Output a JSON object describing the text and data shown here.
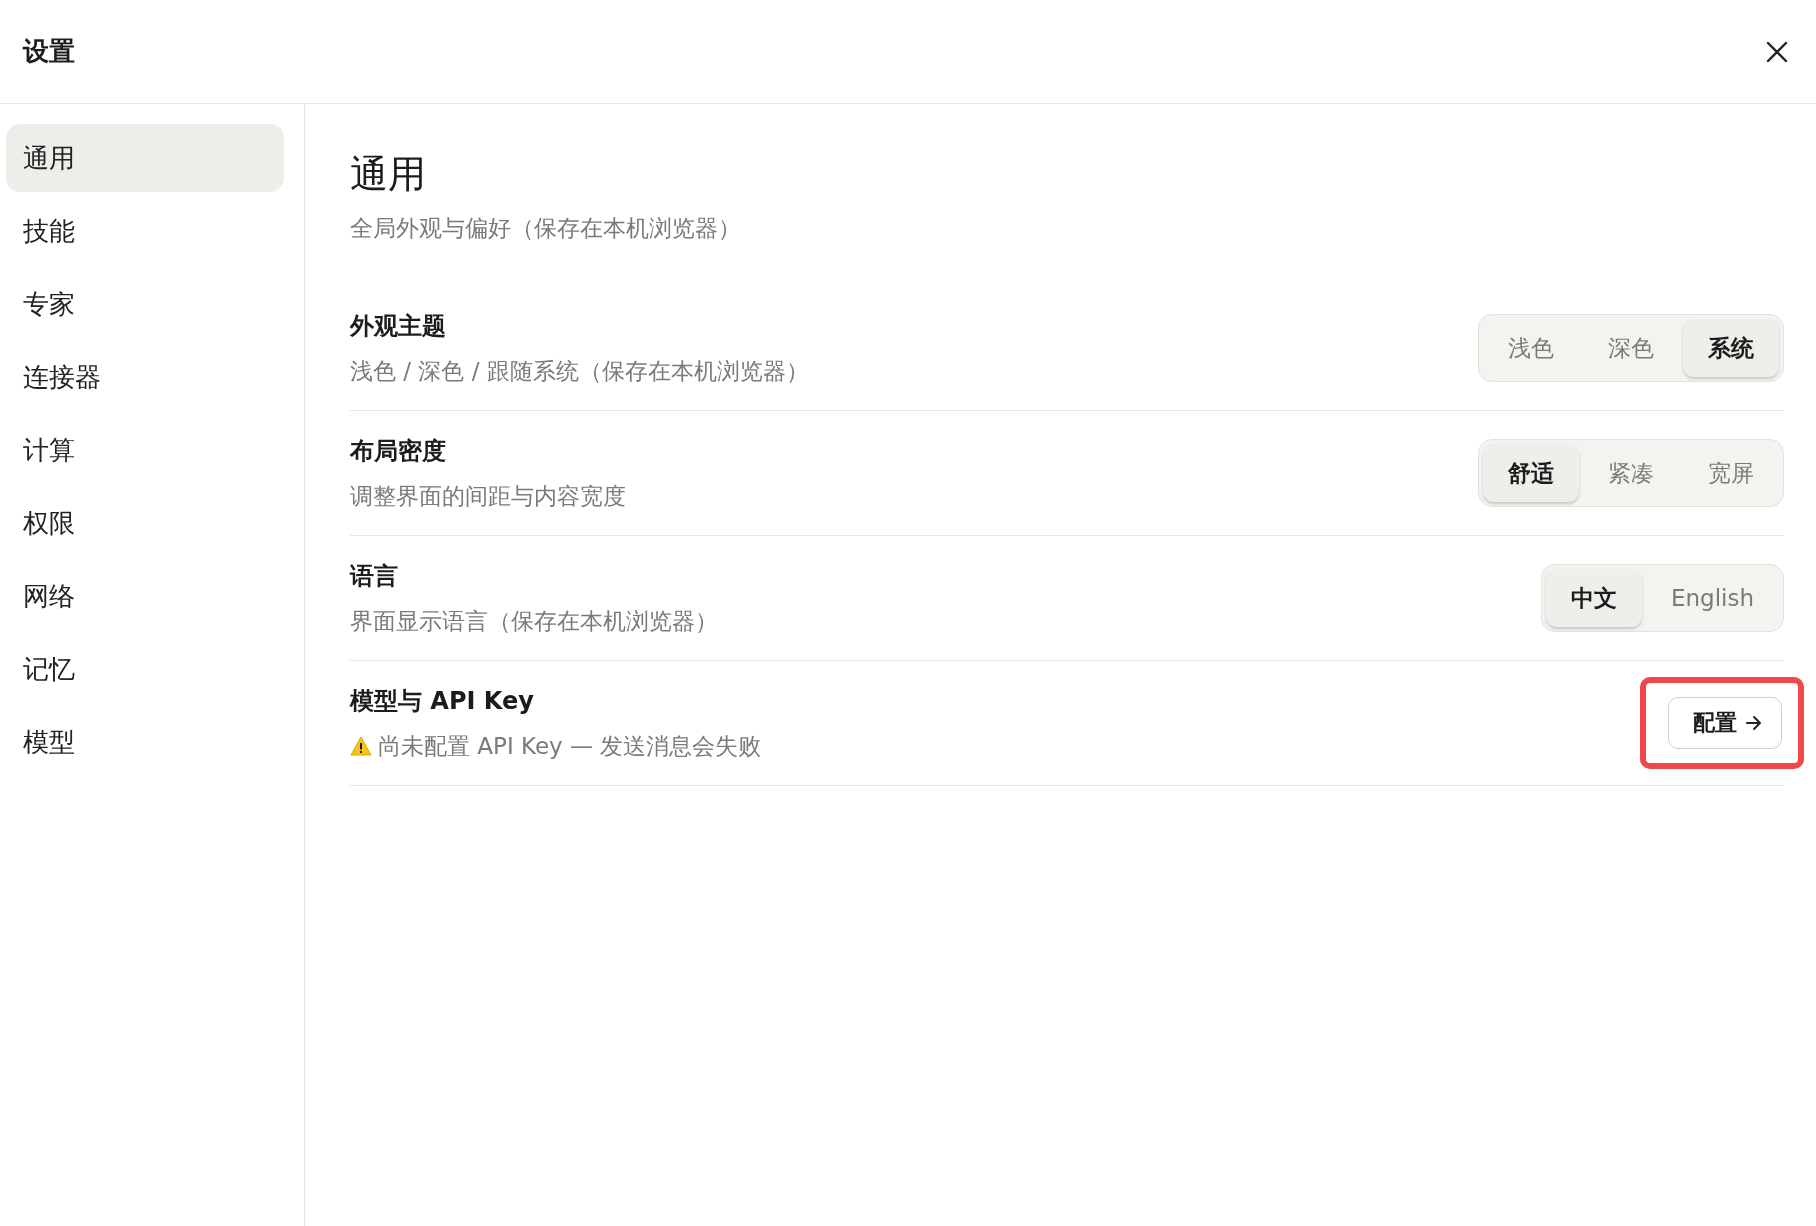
{
  "window": {
    "title": "设置"
  },
  "sidebar": {
    "items": [
      {
        "label": "通用",
        "selected": true
      },
      {
        "label": "技能",
        "selected": false
      },
      {
        "label": "专家",
        "selected": false
      },
      {
        "label": "连接器",
        "selected": false
      },
      {
        "label": "计算",
        "selected": false
      },
      {
        "label": "权限",
        "selected": false
      },
      {
        "label": "网络",
        "selected": false
      },
      {
        "label": "记忆",
        "selected": false
      },
      {
        "label": "模型",
        "selected": false
      }
    ]
  },
  "page": {
    "title": "通用",
    "subtitle": "全局外观与偏好（保存在本机浏览器）"
  },
  "settings": [
    {
      "kind": "segmented",
      "title": "外观主题",
      "description": "浅色 / 深色 / 跟随系统（保存在本机浏览器）",
      "options": [
        {
          "label": "浅色",
          "selected": false
        },
        {
          "label": "深色",
          "selected": false
        },
        {
          "label": "系统",
          "selected": true
        }
      ]
    },
    {
      "kind": "segmented",
      "title": "布局密度",
      "description": "调整界面的间距与内容宽度",
      "options": [
        {
          "label": "舒适",
          "selected": true
        },
        {
          "label": "紧凑",
          "selected": false
        },
        {
          "label": "宽屏",
          "selected": false
        }
      ]
    },
    {
      "kind": "segmented",
      "title": "语言",
      "description": "界面显示语言（保存在本机浏览器）",
      "options": [
        {
          "label": "中文",
          "selected": true
        },
        {
          "label": "English",
          "selected": false
        }
      ]
    },
    {
      "kind": "action",
      "title": "模型与 API Key",
      "warning": true,
      "description": "尚未配置 API Key — 发送消息会失败",
      "button": "配置",
      "highlighted": true
    }
  ]
}
